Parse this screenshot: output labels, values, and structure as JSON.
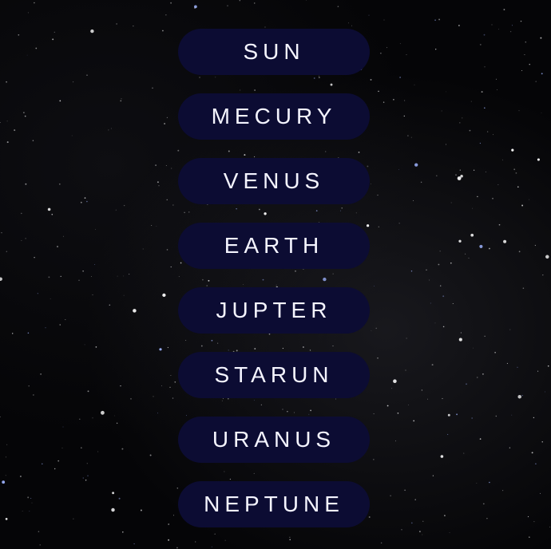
{
  "background": {
    "description_icon": "starry-night-sky",
    "color": "#050507"
  },
  "colors": {
    "button_bg": "#0c0c33",
    "button_text": "#f4f4ff"
  },
  "planets": [
    {
      "label": "SUN"
    },
    {
      "label": "MECURY"
    },
    {
      "label": "VENUS"
    },
    {
      "label": "EARTH"
    },
    {
      "label": "JUPTER"
    },
    {
      "label": "STARUN"
    },
    {
      "label": "URANUS"
    },
    {
      "label": "NEPTUNE"
    }
  ]
}
